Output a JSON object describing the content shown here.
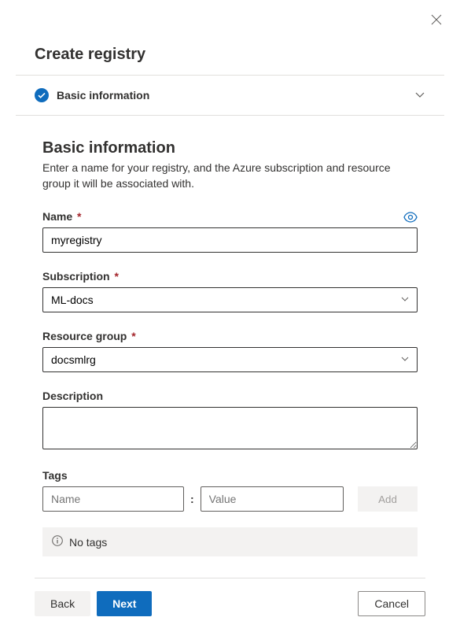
{
  "header": {
    "title": "Create registry"
  },
  "accordion": {
    "title": "Basic information"
  },
  "section": {
    "heading": "Basic information",
    "description": "Enter a name for your registry, and the Azure subscription and resource group it will be associated with."
  },
  "fields": {
    "name": {
      "label": "Name",
      "value": "myregistry"
    },
    "subscription": {
      "label": "Subscription",
      "value": "ML-docs"
    },
    "resource_group": {
      "label": "Resource group",
      "value": "docsmlrg"
    },
    "description": {
      "label": "Description",
      "value": ""
    },
    "tags": {
      "label": "Tags",
      "name_placeholder": "Name",
      "value_placeholder": "Value",
      "add_label": "Add",
      "empty_text": "No tags"
    }
  },
  "footer": {
    "back": "Back",
    "next": "Next",
    "cancel": "Cancel"
  }
}
